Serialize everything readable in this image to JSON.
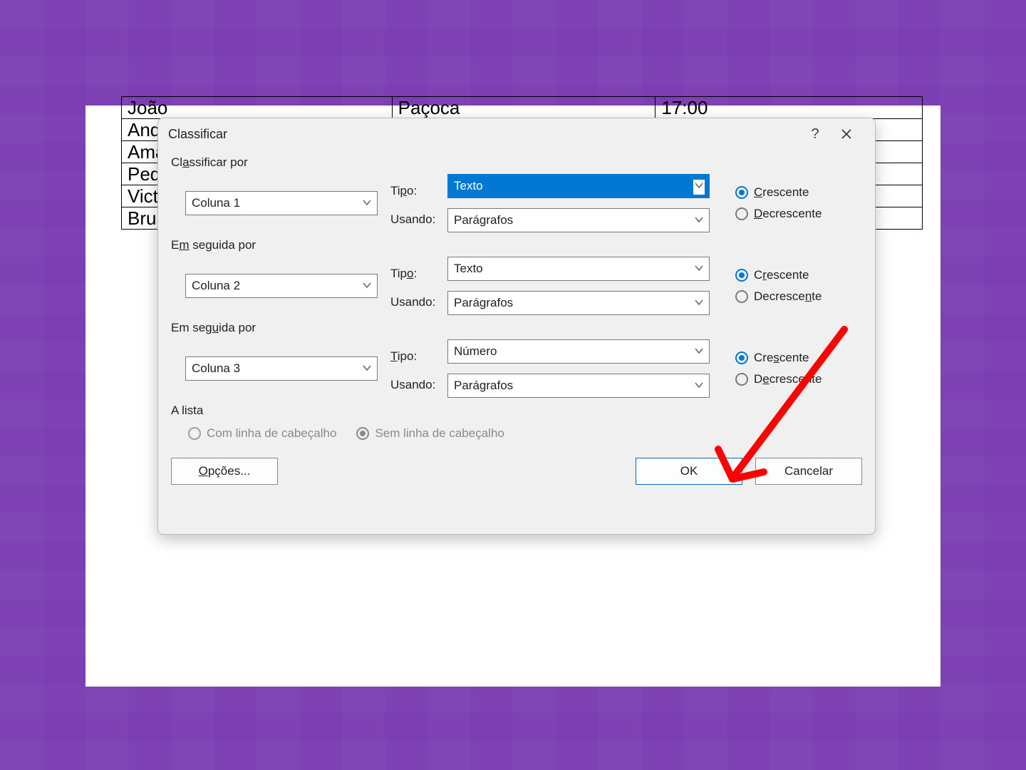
{
  "table": {
    "rows": [
      {
        "c1": "João",
        "c2": "Paçoca",
        "c3": "17:00"
      },
      {
        "c1": "André",
        "c2": "",
        "c3": ""
      },
      {
        "c1": "Amanda",
        "c2": "",
        "c3": ""
      },
      {
        "c1": "Pedro",
        "c2": "",
        "c3": ""
      },
      {
        "c1": "Victor",
        "c2": "",
        "c3": ""
      },
      {
        "c1": "Bruna",
        "c2": "",
        "c3": ""
      }
    ]
  },
  "dialog": {
    "title": "Classificar",
    "group1": {
      "label": "Classificar por",
      "column": "Coluna 1",
      "type_label": "Tipo:",
      "type": "Texto",
      "using_label": "Usando:",
      "using": "Parágrafos",
      "asc": "Crescente",
      "desc": "Decrescente"
    },
    "group2": {
      "label": "Em seguida por",
      "column": "Coluna 2",
      "type_label": "Tipo:",
      "type": "Texto",
      "using_label": "Usando:",
      "using": "Parágrafos",
      "asc": "Crescente",
      "desc": "Decrescente"
    },
    "group3": {
      "label": "Em seguida por",
      "column": "Coluna 3",
      "type_label": "Tipo:",
      "type": "Número",
      "using_label": "Usando:",
      "using": "Parágrafos",
      "asc": "Crescente",
      "desc": "Decrescente"
    },
    "list_label": "A lista",
    "header_yes": "Com linha de cabeçalho",
    "header_no": "Sem linha de cabeçalho",
    "options": "Opções...",
    "ok": "OK",
    "cancel": "Cancelar"
  }
}
